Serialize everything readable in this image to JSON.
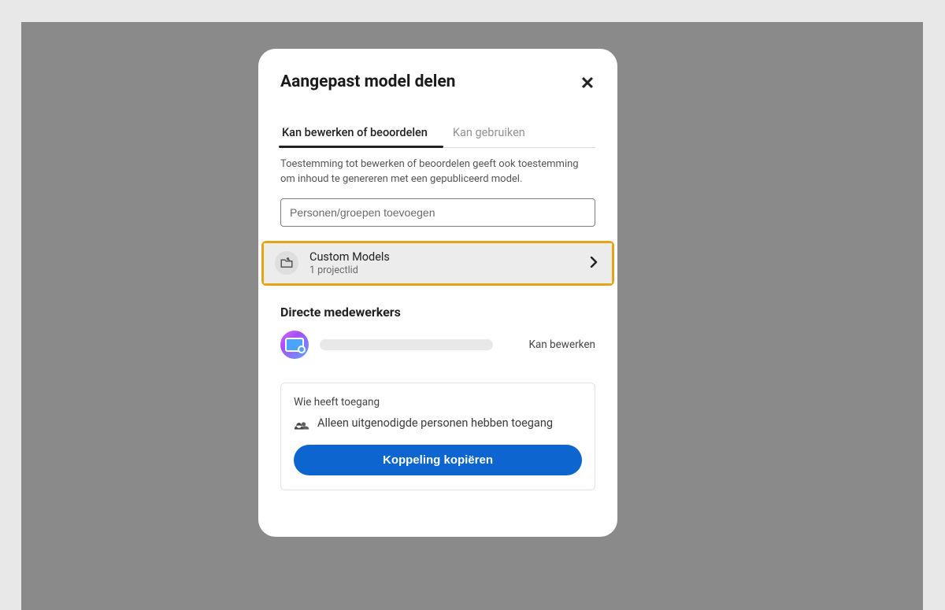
{
  "modal": {
    "title": "Aangepast model delen",
    "tabs": {
      "edit_review": "Kan bewerken of beoordelen",
      "can_use": "Kan gebruiken"
    },
    "help_text": "Toestemming tot bewerken of beoordelen geeft ook toestemming om inhoud te genereren met een gepubliceerd model.",
    "search_placeholder": "Personen/groepen toevoegen",
    "project": {
      "name": "Custom Models",
      "members": "1 projectlid"
    },
    "collaborators": {
      "section_title": "Directe medewerkers",
      "items": [
        {
          "permission": "Kan bewerken"
        }
      ]
    },
    "access": {
      "title": "Wie heeft toegang",
      "line": "Alleen uitgenodigde personen hebben toegang",
      "copy_button": "Koppeling kopiëren"
    }
  }
}
